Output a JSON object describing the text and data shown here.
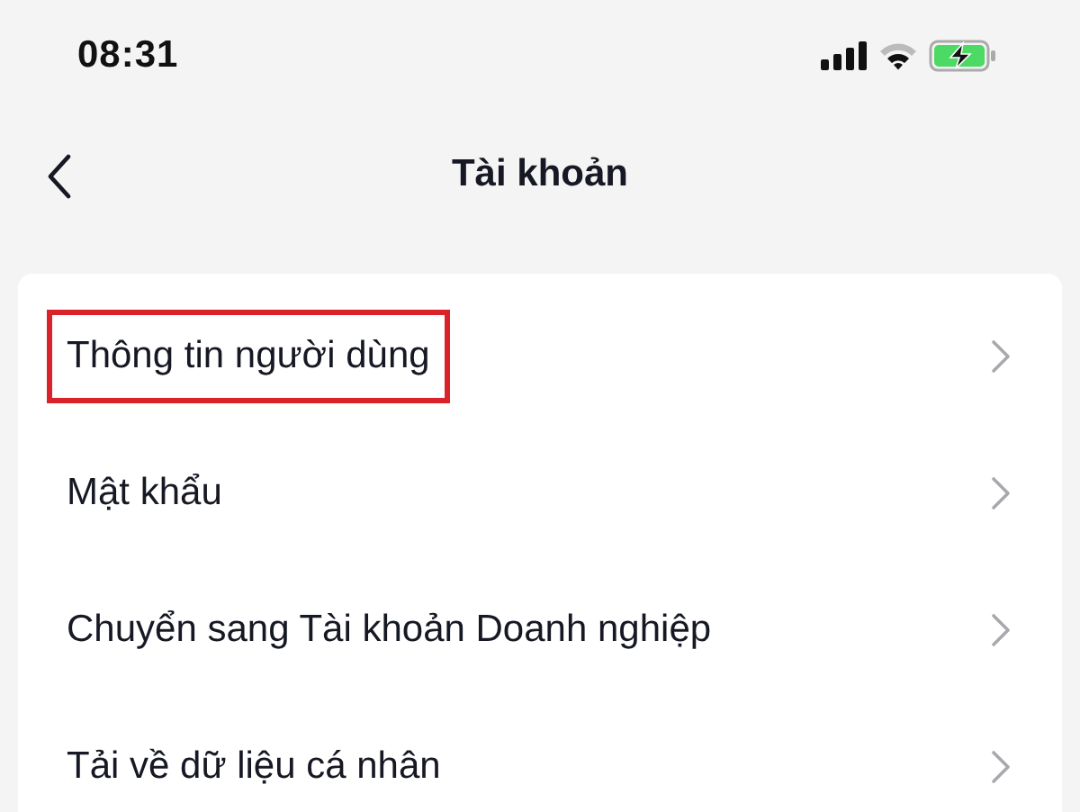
{
  "status_bar": {
    "time": "08:31"
  },
  "header": {
    "title": "Tài khoản"
  },
  "items": [
    {
      "label": "Thông tin người dùng",
      "highlighted": true
    },
    {
      "label": "Mật khẩu",
      "highlighted": false
    },
    {
      "label": "Chuyển sang Tài khoản Doanh nghiệp",
      "highlighted": false
    },
    {
      "label": "Tải về dữ liệu cá nhân",
      "highlighted": false
    }
  ]
}
